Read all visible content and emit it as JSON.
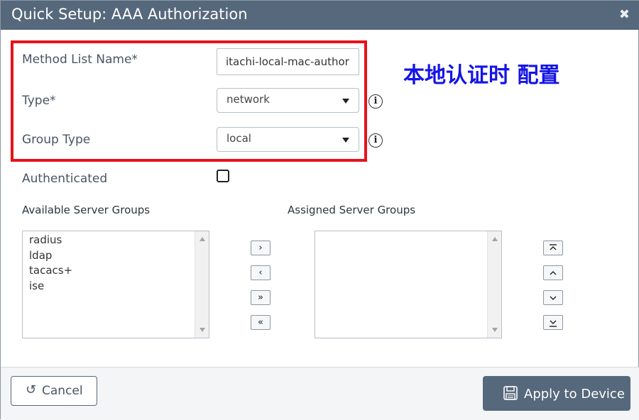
{
  "dialog": {
    "title": "Quick Setup: AAA Authorization",
    "close_glyph": "✖"
  },
  "form": {
    "method_list_name": {
      "label": "Method List Name*",
      "value": "itachi-local-mac-author"
    },
    "type": {
      "label": "Type*",
      "value": "network"
    },
    "group_type": {
      "label": "Group Type",
      "value": "local"
    },
    "authenticated": {
      "label": "Authenticated",
      "checked": false
    }
  },
  "annotation": "本地认证时 配置",
  "available_groups": {
    "label": "Available Server Groups",
    "items": [
      "radius",
      "ldap",
      "tacacs+",
      "ise"
    ]
  },
  "assigned_groups": {
    "label": "Assigned Server Groups",
    "items": []
  },
  "move_buttons": {
    "move_right": "›",
    "move_left": "‹",
    "move_all_right": "»",
    "move_all_left": "«"
  },
  "order_buttons": {
    "top": "⌅",
    "up": "⌃",
    "down": "⌄",
    "bottom": "⌄"
  },
  "footer": {
    "cancel_label": "Cancel",
    "apply_label": "Apply to Device"
  },
  "icons": {
    "info": "i",
    "undo": "↺"
  },
  "colors": {
    "titlebar": "#56687b",
    "highlight_border": "#e6121b",
    "annotation": "#1414e6"
  }
}
